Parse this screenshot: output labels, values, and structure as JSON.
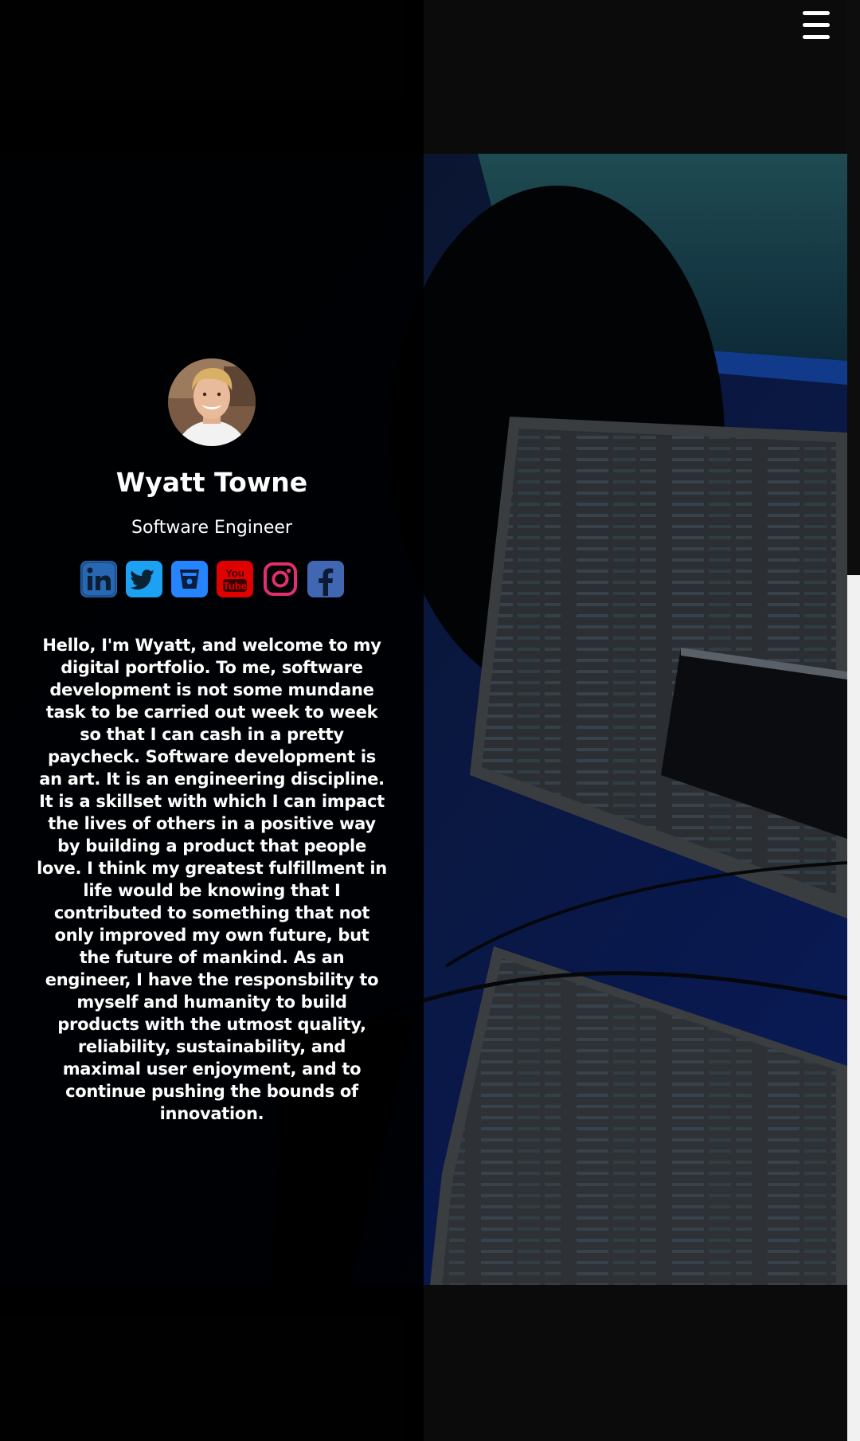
{
  "profile": {
    "name": "Wyatt Towne",
    "title": "Software Engineer",
    "bio": "Hello, I'm Wyatt, and welcome to my digital portfolio. To me, software development is not some mundane task to be carried out week to week so that I can cash in a pretty paycheck. Software development is an art. It is an engineering discipline. It is a skillset with which I can impact the lives of others in a positive way by building a product that people love. I think my greatest fulfillment in life would be knowing that I contributed to something that not only improved my own future, but the future of mankind. As an engineer, I have the responsbility to myself and humanity to build products with the utmost quality, reliability, sustainability, and maximal user enjoyment, and to continue pushing the bounds of innovation."
  },
  "social_links": [
    {
      "name": "linkedin",
      "icon": "linkedin-icon",
      "color": "#2867b2",
      "glyph": "in"
    },
    {
      "name": "twitter",
      "icon": "twitter-icon",
      "color": "#1da1f2",
      "glyph": ""
    },
    {
      "name": "bitbucket",
      "icon": "bitbucket-icon",
      "color": "#2684ff",
      "glyph": ""
    },
    {
      "name": "youtube",
      "icon": "youtube-icon",
      "color": "#e00000",
      "glyph_top": "You",
      "glyph_bottom": "Tube"
    },
    {
      "name": "instagram",
      "icon": "instagram-icon",
      "color": "#e1306c",
      "glyph": ""
    },
    {
      "name": "facebook",
      "icon": "facebook-icon",
      "color": "#4267b2",
      "glyph": "f"
    }
  ],
  "menu": {
    "icon": "hamburger-menu-icon"
  },
  "colors": {
    "background": "#0b0b0b",
    "text": "#ffffff"
  }
}
